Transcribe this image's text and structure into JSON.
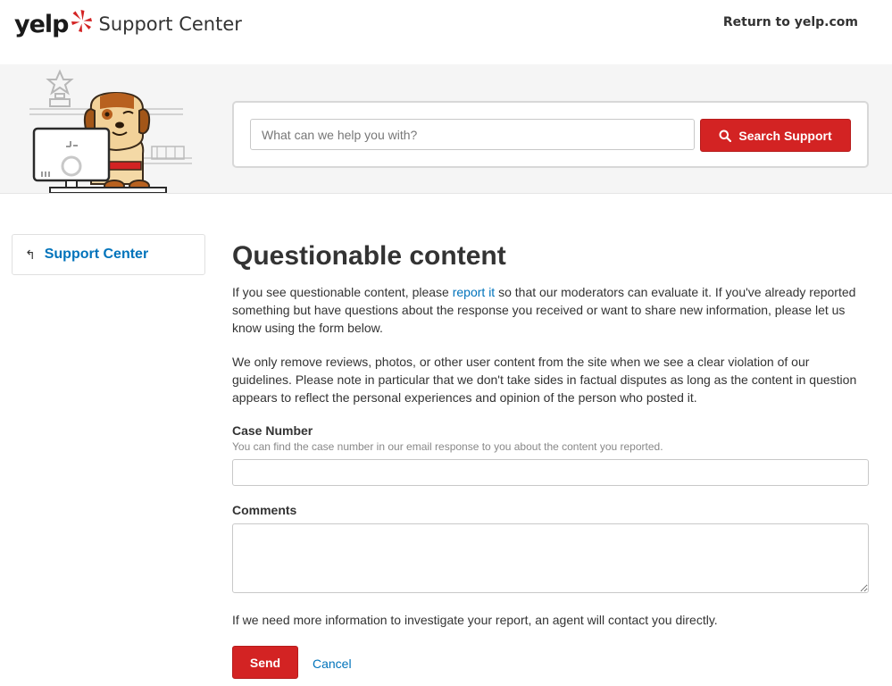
{
  "header": {
    "logo_word": "yelp",
    "logo_subtitle": "Support Center",
    "return_link": "Return to yelp.com"
  },
  "hero": {
    "search_placeholder": "What can we help you with?",
    "search_button": "Search Support"
  },
  "sidebar": {
    "back_label": "Support Center"
  },
  "main": {
    "title": "Questionable content",
    "para1_before": "If you see questionable content, please ",
    "para1_link": "report it",
    "para1_after": " so that our moderators can evaluate it. If you've already reported something but have questions about the response you received or want to share new information, please let us know using the form below.",
    "para2": "We only remove reviews, photos, or other user content from the site when we see a clear violation of our guidelines. Please note in particular that we don't take sides in factual disputes as long as the content in question appears to reflect the personal experiences and opinion of the person who posted it.",
    "case_label": "Case Number",
    "case_help": "You can find the case number in our email response to you about the content you reported.",
    "case_value": "",
    "comments_label": "Comments",
    "comments_value": "",
    "contact_note": "If we need more information to investigate your report, an agent will contact you directly.",
    "send_label": "Send",
    "cancel_label": "Cancel"
  },
  "colors": {
    "brand_red": "#d32323",
    "link_blue": "#0073bb",
    "hero_bg": "#f5f5f5"
  },
  "icons": {
    "logo": "yelp-burst-icon",
    "search": "search-icon",
    "back": "back-arrow-icon",
    "illustration": "dog-at-computer-illustration"
  }
}
